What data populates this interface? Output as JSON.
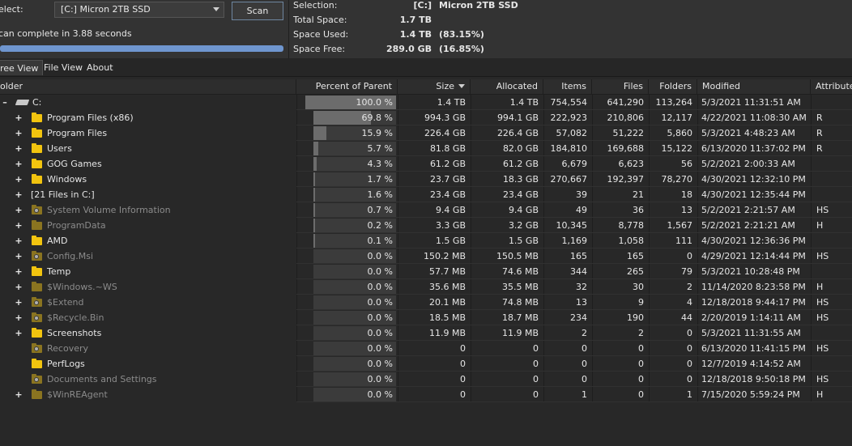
{
  "scanner": {
    "select_label": "elect:",
    "drive_value": "[C:] Micron 2TB SSD",
    "scan_label": "Scan",
    "status": "can complete in 3.88 seconds",
    "progress_percent": 100
  },
  "info": {
    "selection_label": "Selection:",
    "selection_value": "[C:]",
    "selection_name": "Micron 2TB SSD",
    "total_label": "Total Space:",
    "total_value": "1.7 TB",
    "used_label": "Space Used:",
    "used_value": "1.4 TB",
    "used_pct": "(83.15%)",
    "free_label": "Space Free:",
    "free_value": "289.0 GB",
    "free_pct": "(16.85%)"
  },
  "tabs": [
    {
      "label": "ree View",
      "active": true
    },
    {
      "label": "File View",
      "active": false
    },
    {
      "label": "About",
      "active": false
    }
  ],
  "columns": {
    "folder": "older",
    "percent": "Percent of Parent",
    "size": "Size",
    "allocated": "Allocated",
    "items": "Items",
    "files": "Files",
    "folders": "Folders",
    "modified": "Modified",
    "attributes": "Attributes"
  },
  "colors": {
    "folder_normal": "#f2c40f",
    "folder_hidden": "#8a7420",
    "text_dim": "#8b8b8b",
    "progress": "#6f96cf"
  },
  "rows": [
    {
      "name": "C:",
      "icon": "drive-icon",
      "expander": "-",
      "level": 0,
      "dim": false,
      "pct": "100.0 %",
      "pct_value": 100.0,
      "size": "1.4 TB",
      "allocated": "1.4 TB",
      "items": "754,554",
      "files": "641,290",
      "folders": "113,264",
      "modified": "5/3/2021 11:31:51 AM",
      "attrs": ""
    },
    {
      "name": "Program Files (x86)",
      "icon": "folder-icon",
      "expander": "+",
      "level": 1,
      "dim": false,
      "pct": "69.8 %",
      "pct_value": 69.8,
      "size": "994.3 GB",
      "allocated": "994.1 GB",
      "items": "222,923",
      "files": "210,806",
      "folders": "12,117",
      "modified": "4/22/2021 11:08:30 AM",
      "attrs": "R"
    },
    {
      "name": "Program Files",
      "icon": "folder-icon",
      "expander": "+",
      "level": 1,
      "dim": false,
      "pct": "15.9 %",
      "pct_value": 15.9,
      "size": "226.4 GB",
      "allocated": "226.4 GB",
      "items": "57,082",
      "files": "51,222",
      "folders": "5,860",
      "modified": "5/3/2021 4:48:23 AM",
      "attrs": "R"
    },
    {
      "name": "Users",
      "icon": "folder-icon",
      "expander": "+",
      "level": 1,
      "dim": false,
      "pct": "5.7 %",
      "pct_value": 5.7,
      "size": "81.8 GB",
      "allocated": "82.0 GB",
      "items": "184,810",
      "files": "169,688",
      "folders": "15,122",
      "modified": "6/13/2020 11:37:02 PM",
      "attrs": "R"
    },
    {
      "name": "GOG Games",
      "icon": "folder-icon",
      "expander": "+",
      "level": 1,
      "dim": false,
      "pct": "4.3 %",
      "pct_value": 4.3,
      "size": "61.2 GB",
      "allocated": "61.2 GB",
      "items": "6,679",
      "files": "6,623",
      "folders": "56",
      "modified": "5/2/2021 2:00:33 AM",
      "attrs": ""
    },
    {
      "name": "Windows",
      "icon": "folder-icon",
      "expander": "+",
      "level": 1,
      "dim": false,
      "pct": "1.7 %",
      "pct_value": 1.7,
      "size": "23.7 GB",
      "allocated": "18.3 GB",
      "items": "270,667",
      "files": "192,397",
      "folders": "78,270",
      "modified": "4/30/2021 12:32:10 PM",
      "attrs": ""
    },
    {
      "name": "[21 Files in C:]",
      "icon": "none",
      "expander": "+",
      "level": 1,
      "dim": false,
      "pct": "1.6 %",
      "pct_value": 1.6,
      "size": "23.4 GB",
      "allocated": "23.4 GB",
      "items": "39",
      "files": "21",
      "folders": "18",
      "modified": "4/30/2021 12:35:44 PM",
      "attrs": ""
    },
    {
      "name": "System Volume Information",
      "icon": "system-folder-icon",
      "expander": "+",
      "level": 1,
      "dim": true,
      "pct": "0.7 %",
      "pct_value": 0.7,
      "size": "9.4 GB",
      "allocated": "9.4 GB",
      "items": "49",
      "files": "36",
      "folders": "13",
      "modified": "5/2/2021 2:21:57 AM",
      "attrs": "HS"
    },
    {
      "name": "ProgramData",
      "icon": "hidden-folder-icon",
      "expander": "+",
      "level": 1,
      "dim": true,
      "pct": "0.2 %",
      "pct_value": 0.2,
      "size": "3.3 GB",
      "allocated": "3.2 GB",
      "items": "10,345",
      "files": "8,778",
      "folders": "1,567",
      "modified": "5/2/2021 2:21:21 AM",
      "attrs": "H"
    },
    {
      "name": "AMD",
      "icon": "folder-icon",
      "expander": "+",
      "level": 1,
      "dim": false,
      "pct": "0.1 %",
      "pct_value": 0.1,
      "size": "1.5 GB",
      "allocated": "1.5 GB",
      "items": "1,169",
      "files": "1,058",
      "folders": "111",
      "modified": "4/30/2021 12:36:36 PM",
      "attrs": ""
    },
    {
      "name": "Config.Msi",
      "icon": "system-folder-icon",
      "expander": "+",
      "level": 1,
      "dim": true,
      "pct": "0.0 %",
      "pct_value": 0.0,
      "size": "150.2 MB",
      "allocated": "150.5 MB",
      "items": "165",
      "files": "165",
      "folders": "0",
      "modified": "4/29/2021 12:14:44 PM",
      "attrs": "HS"
    },
    {
      "name": "Temp",
      "icon": "folder-icon",
      "expander": "+",
      "level": 1,
      "dim": false,
      "pct": "0.0 %",
      "pct_value": 0.0,
      "size": "57.7 MB",
      "allocated": "74.6 MB",
      "items": "344",
      "files": "265",
      "folders": "79",
      "modified": "5/3/2021 10:28:48 PM",
      "attrs": ""
    },
    {
      "name": "$Windows.~WS",
      "icon": "hidden-folder-icon",
      "expander": "+",
      "level": 1,
      "dim": true,
      "pct": "0.0 %",
      "pct_value": 0.0,
      "size": "35.6 MB",
      "allocated": "35.5 MB",
      "items": "32",
      "files": "30",
      "folders": "2",
      "modified": "11/14/2020 8:23:58 PM",
      "attrs": "H"
    },
    {
      "name": "$Extend",
      "icon": "system-folder-icon",
      "expander": "+",
      "level": 1,
      "dim": true,
      "pct": "0.0 %",
      "pct_value": 0.0,
      "size": "20.1 MB",
      "allocated": "74.8 MB",
      "items": "13",
      "files": "9",
      "folders": "4",
      "modified": "12/18/2018 9:44:17 PM",
      "attrs": "HS"
    },
    {
      "name": "$Recycle.Bin",
      "icon": "system-folder-icon",
      "expander": "+",
      "level": 1,
      "dim": true,
      "pct": "0.0 %",
      "pct_value": 0.0,
      "size": "18.5 MB",
      "allocated": "18.7 MB",
      "items": "234",
      "files": "190",
      "folders": "44",
      "modified": "2/20/2019 1:14:11 AM",
      "attrs": "HS"
    },
    {
      "name": "Screenshots",
      "icon": "folder-icon",
      "expander": "+",
      "level": 1,
      "dim": false,
      "pct": "0.0 %",
      "pct_value": 0.0,
      "size": "11.9 MB",
      "allocated": "11.9 MB",
      "items": "2",
      "files": "2",
      "folders": "0",
      "modified": "5/3/2021 11:31:55 AM",
      "attrs": ""
    },
    {
      "name": "Recovery",
      "icon": "system-folder-icon",
      "expander": "",
      "level": 1,
      "dim": true,
      "pct": "0.0 %",
      "pct_value": 0.0,
      "size": "0",
      "allocated": "0",
      "items": "0",
      "files": "0",
      "folders": "0",
      "modified": "6/13/2020 11:41:15 PM",
      "attrs": "HS"
    },
    {
      "name": "PerfLogs",
      "icon": "folder-icon",
      "expander": "",
      "level": 1,
      "dim": false,
      "pct": "0.0 %",
      "pct_value": 0.0,
      "size": "0",
      "allocated": "0",
      "items": "0",
      "files": "0",
      "folders": "0",
      "modified": "12/7/2019 4:14:52 AM",
      "attrs": ""
    },
    {
      "name": "Documents and Settings",
      "icon": "system-folder-icon",
      "expander": "",
      "level": 1,
      "dim": true,
      "pct": "0.0 %",
      "pct_value": 0.0,
      "size": "0",
      "allocated": "0",
      "items": "0",
      "files": "0",
      "folders": "0",
      "modified": "12/18/2018 9:50:18 PM",
      "attrs": "HS"
    },
    {
      "name": "$WinREAgent",
      "icon": "hidden-folder-icon",
      "expander": "+",
      "level": 1,
      "dim": true,
      "pct": "0.0 %",
      "pct_value": 0.0,
      "size": "0",
      "allocated": "0",
      "items": "1",
      "files": "0",
      "folders": "1",
      "modified": "7/15/2020 5:59:24 PM",
      "attrs": "H"
    }
  ]
}
